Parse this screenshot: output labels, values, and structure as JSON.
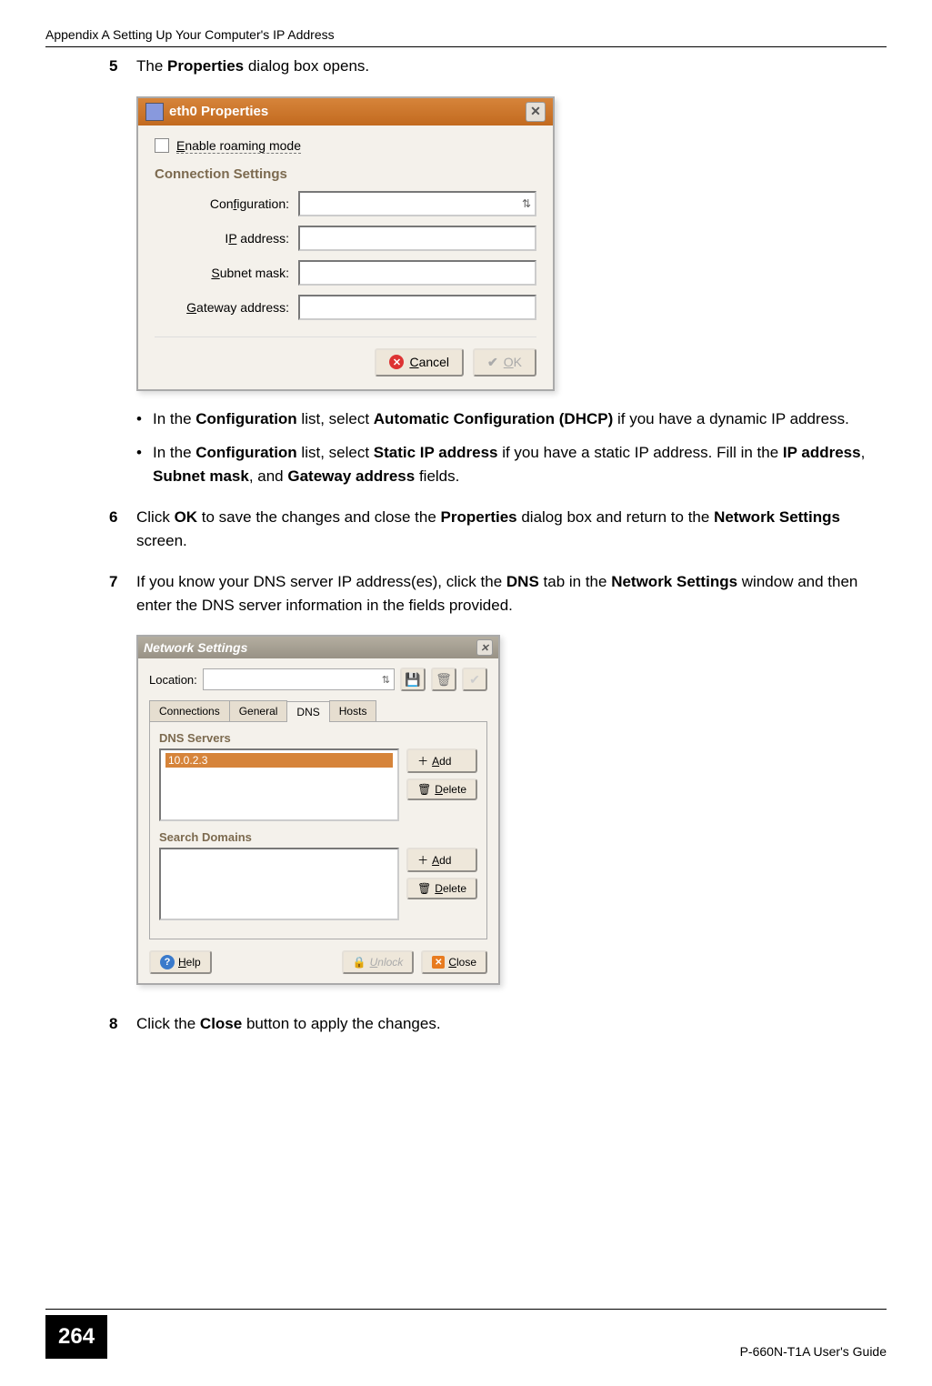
{
  "header": "Appendix A Setting Up Your Computer's IP Address",
  "steps": {
    "s5": {
      "num": "5",
      "pre": "The ",
      "b1": "Properties",
      "post": " dialog box opens."
    },
    "s6": {
      "num": "6",
      "pre": "Click ",
      "b1": "OK",
      "mid1": " to save the changes and close the ",
      "b2": "Properties",
      "mid2": " dialog box and return to the ",
      "b3": "Network Settings",
      "post": " screen."
    },
    "s7": {
      "num": "7",
      "pre": "If you know your DNS server IP address(es), click the ",
      "b1": "DNS",
      "mid1": " tab in the ",
      "b2": "Network Settings",
      "post": " window and then enter the DNS server information in the fields provided."
    },
    "s8": {
      "num": "8",
      "pre": "Click the ",
      "b1": "Close",
      "post": " button to apply the changes."
    }
  },
  "bullets": {
    "b1": {
      "pre": "In the ",
      "b1": "Configuration",
      "mid1": " list, select ",
      "b2": "Automatic Configuration (DHCP)",
      "post": " if you have a dynamic IP address."
    },
    "b2": {
      "pre": "In the ",
      "b1": "Configuration",
      "mid1": " list, select ",
      "b2": "Static IP address",
      "mid2": " if you have a static IP address. Fill in the ",
      "b3": "IP address",
      "c1": ", ",
      "b4": "Subnet mask",
      "c2": ", and ",
      "b5": "Gateway address",
      "post": " fields."
    }
  },
  "dlg1": {
    "title": "eth0 Properties",
    "enable": "Enable roaming mode",
    "section": "Connection Settings",
    "config": "Configuration:",
    "ip": "IP address:",
    "subnet": "Subnet mask:",
    "gateway": "Gateway address:",
    "cancel": "Cancel",
    "ok": "OK",
    "u_ip_char": "P",
    "u_subnet_char": "S",
    "u_gateway_char": "G",
    "u_enable_char": "E",
    "u_config_char": "f",
    "u_cancel_char": "C",
    "u_ok_char": "O"
  },
  "dlg2": {
    "title": "Network Settings",
    "location": "Location:",
    "tabs": {
      "connections": "Connections",
      "general": "General",
      "dns": "DNS",
      "hosts": "Hosts"
    },
    "dns_servers": "DNS Servers",
    "search_domains": "Search Domains",
    "dns_entry": "10.0.2.3",
    "add": "Add",
    "delete": "Delete",
    "help": "Help",
    "unlock": "Unlock",
    "close": "Close"
  },
  "footer": {
    "page": "264",
    "guide": "P-660N-T1A User's Guide"
  }
}
